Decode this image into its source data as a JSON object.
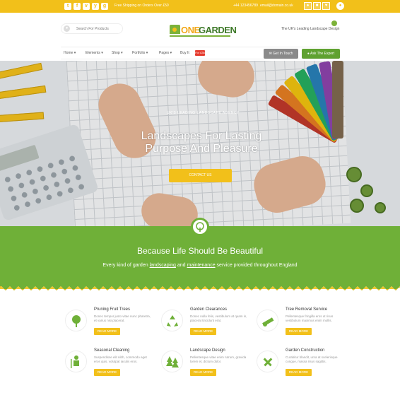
{
  "topbar": {
    "social": [
      "t",
      "f",
      "v",
      "y",
      "g"
    ],
    "shipping_text": "Free Shipping on Orders Over £50",
    "phone": "+44 123456789",
    "email": "email@domain.co.uk",
    "user_icons": [
      "user",
      "lock",
      "heart"
    ],
    "accent_color": "#f2c01a"
  },
  "header": {
    "search_placeholder": "Search For Products",
    "logo": {
      "one": "ONE",
      "garden": "GARDEN"
    },
    "tagline": "The UK's Leading Landscape Design"
  },
  "nav": {
    "items": [
      "Home",
      "Elements",
      "Shop",
      "Portfolio",
      "Pages",
      "Buy It"
    ],
    "sale_badge": "For £36",
    "get_in_touch": "Get In Touch",
    "ask_expert": "Ask The Expert"
  },
  "hero": {
    "tagline": "UK'S LEADING LANDSCAPE AGENCY",
    "title_line1": "Landscapes For Lasting",
    "title_line2": "Purpose And Pleasure",
    "cta": "CONTACT US"
  },
  "band": {
    "heading": "Because Life Should Be Beautiful",
    "sub_before": "Every kind of garden ",
    "sub_link1": "landscaping",
    "sub_mid": " and ",
    "sub_link2": "maintenance",
    "sub_after": " service provided throughout England",
    "color": "#6fb038"
  },
  "services": [
    {
      "title": "Pruning Fruit Trees",
      "desc": "Donec tempor justo vitae nunc pharetra, et varius nisi placerat.",
      "more": "READ MORE",
      "icon": "tree-icon"
    },
    {
      "title": "Garden Clearances",
      "desc": "Donec nulla felis, vestibulum at quam in, placerat tincidunt erat.",
      "more": "READ MORE",
      "icon": "recycle-icon"
    },
    {
      "title": "Tree Removal Service",
      "desc": "Pellentesque fringilla eros ut risus vestibulum maximus enim mollis.",
      "more": "READ MORE",
      "icon": "chainsaw-icon"
    },
    {
      "title": "Seasonal Cleaning",
      "desc": "Suspendisse elit nibh, commodo eget eros quis, volutpat iaculis eros.",
      "more": "READ MORE",
      "icon": "gardener-icon"
    },
    {
      "title": "Landscape Design",
      "desc": "Pellentesque vitae enim rutrum, gravida lorem et, dictum dolor.",
      "more": "READ MORE",
      "icon": "forest-icon"
    },
    {
      "title": "Garden Construction",
      "desc": "Curabitur blandit, urna at scelerisque congue, massa risus sagittis.",
      "more": "READ MORE",
      "icon": "tools-icon"
    }
  ]
}
